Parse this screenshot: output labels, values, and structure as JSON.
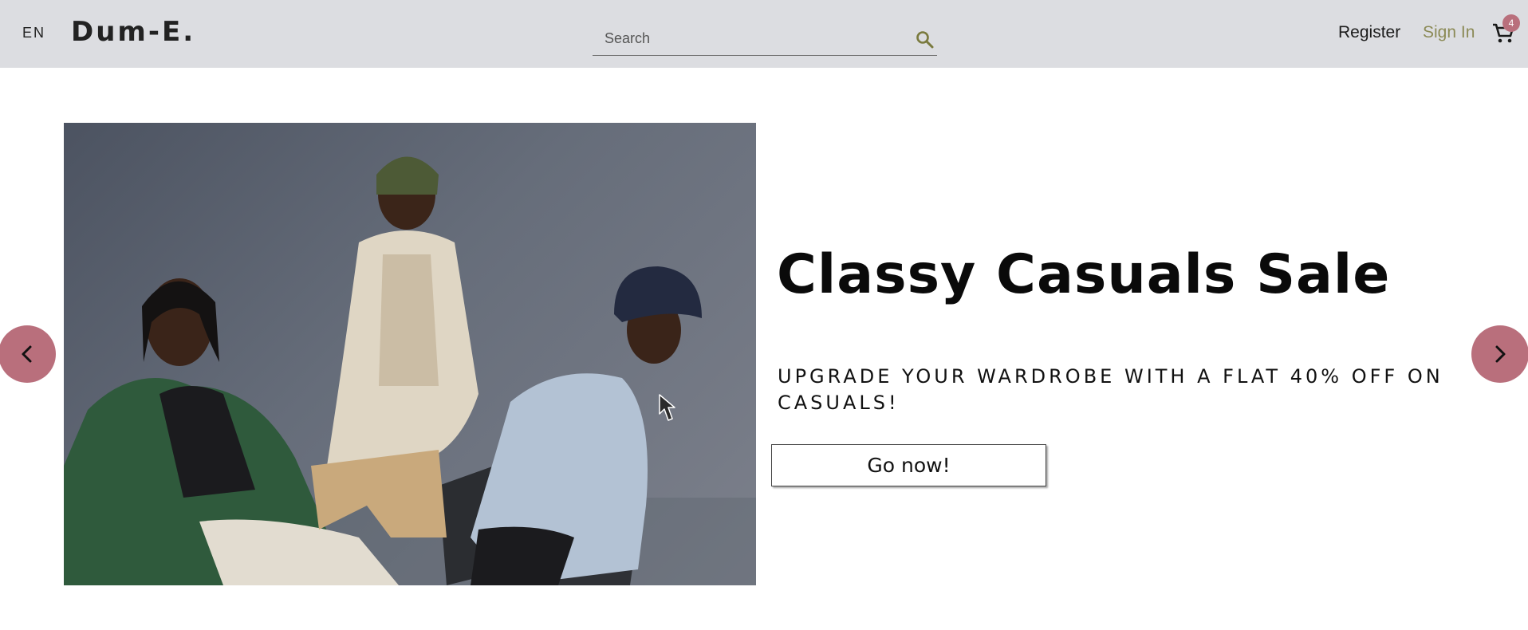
{
  "header": {
    "language": "EN",
    "logo": "Dum-E.",
    "search": {
      "placeholder": "Search",
      "value": ""
    },
    "nav": {
      "register": "Register",
      "sign_in": "Sign In"
    },
    "cart": {
      "count": "4"
    }
  },
  "hero": {
    "title": "Classy Casuals Sale",
    "subtitle": "UPGRADE YOUR WARDROBE WITH A FLAT 40% OFF ON CASUALS!",
    "cta": "Go now!"
  },
  "icons": {
    "search": "search-icon",
    "cart": "cart-icon",
    "prev": "chevron-left-icon",
    "next": "chevron-right-icon"
  },
  "colors": {
    "header_bg": "#dcdde1",
    "accent": "#b96f7c",
    "sign_in": "#8b8a56",
    "search_icon": "#7a7a3e"
  }
}
